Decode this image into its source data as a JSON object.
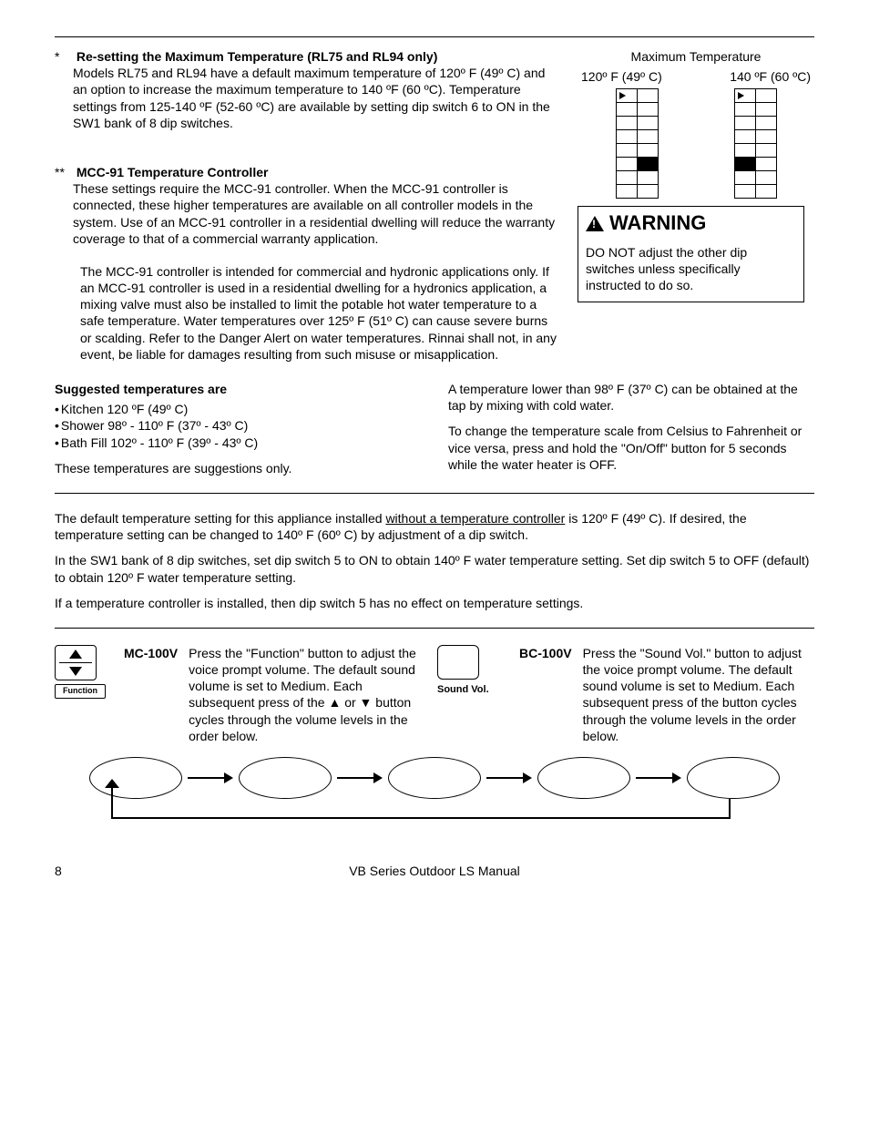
{
  "sections": {
    "resetting": {
      "marker": "*",
      "title": "Re-setting the Maximum Temperature (RL75 and RL94 only)",
      "body": "Models RL75 and RL94 have a default maximum temperature of 120º F (49º C) and an option to increase the maximum temperature to 140 ºF (60 ºC).  Temperature settings from 125-140 ºF (52-60 ºC) are available by setting dip switch 6 to ON in the SW1 bank of 8 dip switches."
    },
    "mcc91": {
      "marker": "**",
      "title": "MCC-91 Temperature Controller",
      "body1": "These settings require the MCC-91 controller.  When the MCC-91 controller is connected, these higher temperatures are available on all controller models in the system. Use of an MCC-91 controller in a residential dwelling will reduce the warranty coverage to that of a commercial warranty application.",
      "body2": "The MCC-91 controller is intended for commercial and hydronic applications only. If an MCC-91 controller is used in a residential dwelling for a hydronics application, a mixing valve must also be installed to limit the potable hot water temperature to a safe temperature. Water temperatures over 125º F (51º C) can cause severe burns or scalding. Refer to the Danger Alert on water temperatures. Rinnai shall not, in any event, be liable for damages resulting from such misuse or misapplication."
    },
    "suggested": {
      "title": "Suggested temperatures are",
      "items": [
        "Kitchen  120 ºF (49º C)",
        "Shower  98º - 110º F (37º - 43º C)",
        "Bath Fill 102º - 110º F (39º - 43º C)"
      ],
      "note": "These temperatures are suggestions only.",
      "rightP1": "A temperature lower than 98º F (37º C) can be obtained at the tap by mixing with cold water.",
      "rightP2": "To change the temperature scale from Celsius to Fahrenheit or vice versa, press and hold the \"On/Off\" button for 5 seconds while the water heater is OFF."
    }
  },
  "dipDiagram": {
    "title": "Maximum Temperature",
    "left_label": "120º F (49º C)",
    "right_label": "140 ºF (60 ºC)"
  },
  "warning": {
    "heading": "WARNING",
    "body": "DO NOT adjust the other dip switches unless specifically instructed to do so."
  },
  "defaultTemp": {
    "p1a": "The default temperature setting for this appliance installed ",
    "p1u": "without a temperature controller",
    "p1b": " is 120º F (49º C).  If desired, the temperature setting can be changed to 140º F (60º C) by adjustment of a dip switch.",
    "p2": "In the SW1 bank of 8 dip switches, set dip switch 5 to ON to obtain 140º F water temperature setting.  Set dip switch 5 to OFF (default) to obtain 120º F water temperature setting.",
    "p3": "If a temperature controller is installed, then dip switch 5 has no effect on temperature settings."
  },
  "controllers": {
    "mc100v": {
      "name": "MC-100V",
      "desc": "Press the \"Function\" button to adjust the voice prompt volume.  The default sound volume is set to Medium.  Each subsequent press of the ▲ or ▼ button cycles through the volume levels in the order below.",
      "btn_label": "Function"
    },
    "bc100v": {
      "name": "BC-100V",
      "desc": "Press the \"Sound Vol.\" button to adjust the voice prompt volume.  The default sound volume is set to Medium.  Each subsequent press of the button cycles through the volume levels in the order below.",
      "btn_label": "Sound Vol."
    }
  },
  "footer": {
    "page": "8",
    "title": "VB Series Outdoor LS Manual"
  }
}
